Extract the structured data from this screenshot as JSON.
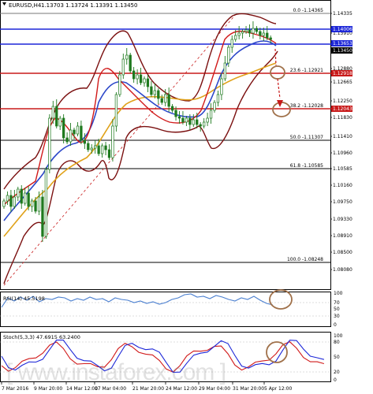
{
  "header": {
    "symbol": "EURUSD,H4",
    "ohlc": "1.13703 1.13724 1.13391 1.13450"
  },
  "price_scale": {
    "labels": [
      "1.14335",
      "1.13910",
      "1.13450",
      "1.12880",
      "1.12665",
      "1.12250",
      "1.11830",
      "1.11410",
      "1.10960",
      "1.10585",
      "1.10160",
      "1.09750",
      "1.09330",
      "1.08910",
      "1.08500",
      "1.08080"
    ]
  },
  "price_tags": [
    {
      "label": "1.14006",
      "color": "#1d27d8"
    },
    {
      "label": "1.13653",
      "color": "#1d27d8"
    },
    {
      "label": "1.13450",
      "color": "#000000"
    },
    {
      "label": "1.12918",
      "color": "#c81a1a"
    },
    {
      "label": "1.12043",
      "color": "#c81a1a"
    }
  ],
  "fibo": [
    {
      "label": "0.0 -1.14365"
    },
    {
      "label": "23.6 -1.12921"
    },
    {
      "label": "38.2 -1.12028"
    },
    {
      "label": "50.0 -1.11307"
    },
    {
      "label": "61.8 -1.10585"
    },
    {
      "label": "100.0 -1.08248"
    }
  ],
  "rsi": {
    "label": "RSI(14) 45.5198",
    "scale": [
      "100",
      "70",
      "50",
      "30",
      "0"
    ]
  },
  "stoch": {
    "label": "Stoch(5,3,3) 47.6915 63.2400",
    "scale": [
      "100",
      "80",
      "50",
      "20",
      "0"
    ]
  },
  "time_axis": {
    "labels": [
      "7 Mar 2016",
      "9 Mar 20:00",
      "14 Mar 12:00",
      "17 Mar 04:00",
      "21 Mar 20:00",
      "24 Mar 12:00",
      "29 Mar 04:00",
      "31 Mar 20:00",
      "5 Apr 12:00"
    ]
  },
  "watermark": "[ www.instaforex.com ]",
  "colors": {
    "bollinger": "#7b1010",
    "ma_fast": "#d11a1a",
    "ma_mid": "#2c47c9",
    "ma_slow": "#e0a21a",
    "candle_up": "#1e7a1e",
    "candle_down": "#1e7a1e",
    "support_line": "#c81a1a",
    "resistance_line": "#1d27d8",
    "rsi_line": "#4a7fd0",
    "stoch_main": "#1d27d8",
    "stoch_signal": "#d11a1a",
    "annotation": "#a0714a"
  }
}
